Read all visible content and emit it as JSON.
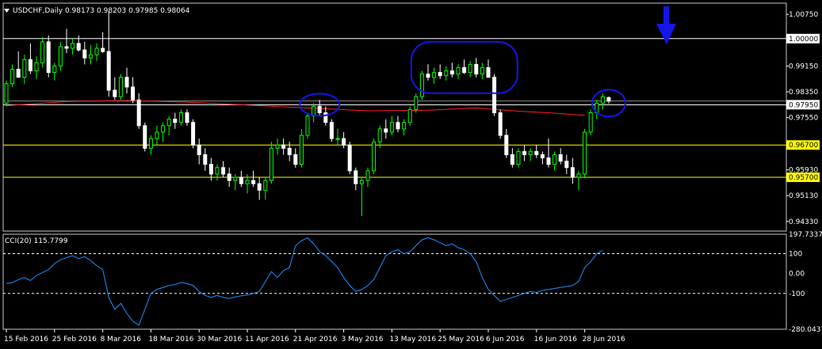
{
  "window": {
    "symbol_title": "USDCHF,Daily  0.98173 0.98203 0.97985 0.98064",
    "menu_icon": "triangle-down-icon"
  },
  "colors": {
    "background": "#000000",
    "frame": "#c8c8c8",
    "bull_candle": "#00ff00",
    "bear_candle": "#ffffff",
    "ma_line": "#ff2020",
    "hline_white": "#ffffff",
    "hline_yellow": "#ffff00",
    "label_bg_yellow": "#ffff00",
    "label_bg_white": "#ffffff",
    "cci_line": "#1e90ff",
    "annotation": "#1515e6"
  },
  "chart_data": [
    {
      "type": "candlestick",
      "title": "USDCHF,Daily  0.98173 0.98203 0.97985 0.98064",
      "ylim": [
        0.9408,
        1.0105
      ],
      "y_ticks": [
        "1.00750",
        "0.99150",
        "0.98350",
        "0.97550",
        "0.95930",
        "0.95130",
        "0.94330"
      ],
      "date_ticks": [
        "15 Feb 2016",
        "25 Feb 2016",
        "8 Mar 2016",
        "18 Mar 2016",
        "30 Mar 2016",
        "11 Apr 2016",
        "21 Apr 2016",
        "3 May 2016",
        "13 May 2016",
        "25 May 2016",
        "6 Jun 2016",
        "16 Jun 2016",
        "28 Jun 2016"
      ],
      "date_tick_index": [
        0,
        8,
        16,
        24,
        32,
        40,
        48,
        56,
        64,
        72,
        80,
        88,
        96
      ],
      "horizontal_levels": [
        {
          "value": 1.0,
          "label": "1.00000",
          "color": "white"
        },
        {
          "value": 0.9795,
          "label": "0.97950",
          "color": "white"
        },
        {
          "value": 0.967,
          "label": "0.96700",
          "color": "yellow"
        },
        {
          "value": 0.957,
          "label": "0.95700",
          "color": "yellow"
        }
      ],
      "current_price": 0.98064,
      "moving_average": {
        "points": [
          [
            0,
            0.9792
          ],
          [
            10,
            0.9805
          ],
          [
            20,
            0.9808
          ],
          [
            30,
            0.9803
          ],
          [
            40,
            0.9794
          ],
          [
            50,
            0.9785
          ],
          [
            60,
            0.9776
          ],
          [
            70,
            0.9778
          ],
          [
            78,
            0.9785
          ],
          [
            85,
            0.9775
          ],
          [
            90,
            0.977
          ],
          [
            96,
            0.9762
          ]
        ]
      },
      "candles": [
        {
          "o": 0.98,
          "h": 0.987,
          "l": 0.979,
          "c": 0.986
        },
        {
          "o": 0.986,
          "h": 0.992,
          "l": 0.985,
          "c": 0.9905
        },
        {
          "o": 0.9905,
          "h": 0.996,
          "l": 0.988,
          "c": 0.988
        },
        {
          "o": 0.988,
          "h": 0.995,
          "l": 0.986,
          "c": 0.9935
        },
        {
          "o": 0.9935,
          "h": 0.9985,
          "l": 0.989,
          "c": 0.99
        },
        {
          "o": 0.99,
          "h": 0.9945,
          "l": 0.9875,
          "c": 0.9925
        },
        {
          "o": 0.9925,
          "h": 1.0005,
          "l": 0.991,
          "c": 0.999
        },
        {
          "o": 0.999,
          "h": 1.001,
          "l": 0.988,
          "c": 0.9895
        },
        {
          "o": 0.9895,
          "h": 0.9925,
          "l": 0.987,
          "c": 0.9915
        },
        {
          "o": 0.9915,
          "h": 0.999,
          "l": 0.99,
          "c": 0.9975
        },
        {
          "o": 0.9975,
          "h": 1.003,
          "l": 0.9955,
          "c": 0.997
        },
        {
          "o": 0.997,
          "h": 1.0,
          "l": 0.995,
          "c": 0.9985
        },
        {
          "o": 0.9985,
          "h": 1.001,
          "l": 0.996,
          "c": 0.9965
        },
        {
          "o": 0.9965,
          "h": 0.999,
          "l": 0.992,
          "c": 0.994
        },
        {
          "o": 0.994,
          "h": 0.998,
          "l": 0.992,
          "c": 0.995
        },
        {
          "o": 0.995,
          "h": 0.9985,
          "l": 0.993,
          "c": 0.997
        },
        {
          "o": 0.997,
          "h": 1.002,
          "l": 0.9955,
          "c": 0.996
        },
        {
          "o": 0.996,
          "h": 1.0085,
          "l": 0.982,
          "c": 0.984
        },
        {
          "o": 0.984,
          "h": 0.988,
          "l": 0.981,
          "c": 0.982
        },
        {
          "o": 0.982,
          "h": 0.989,
          "l": 0.981,
          "c": 0.988
        },
        {
          "o": 0.988,
          "h": 0.991,
          "l": 0.983,
          "c": 0.985
        },
        {
          "o": 0.985,
          "h": 0.988,
          "l": 0.98,
          "c": 0.981
        },
        {
          "o": 0.981,
          "h": 0.983,
          "l": 0.972,
          "c": 0.973
        },
        {
          "o": 0.973,
          "h": 0.974,
          "l": 0.965,
          "c": 0.966
        },
        {
          "o": 0.966,
          "h": 0.97,
          "l": 0.964,
          "c": 0.969
        },
        {
          "o": 0.969,
          "h": 0.973,
          "l": 0.967,
          "c": 0.971
        },
        {
          "o": 0.971,
          "h": 0.974,
          "l": 0.968,
          "c": 0.973
        },
        {
          "o": 0.973,
          "h": 0.976,
          "l": 0.97,
          "c": 0.975
        },
        {
          "o": 0.975,
          "h": 0.977,
          "l": 0.972,
          "c": 0.974
        },
        {
          "o": 0.974,
          "h": 0.978,
          "l": 0.973,
          "c": 0.977
        },
        {
          "o": 0.977,
          "h": 0.978,
          "l": 0.973,
          "c": 0.974
        },
        {
          "o": 0.974,
          "h": 0.975,
          "l": 0.966,
          "c": 0.967
        },
        {
          "o": 0.967,
          "h": 0.969,
          "l": 0.961,
          "c": 0.964
        },
        {
          "o": 0.964,
          "h": 0.966,
          "l": 0.959,
          "c": 0.961
        },
        {
          "o": 0.961,
          "h": 0.963,
          "l": 0.956,
          "c": 0.958
        },
        {
          "o": 0.958,
          "h": 0.961,
          "l": 0.956,
          "c": 0.96
        },
        {
          "o": 0.96,
          "h": 0.962,
          "l": 0.957,
          "c": 0.958
        },
        {
          "o": 0.958,
          "h": 0.96,
          "l": 0.954,
          "c": 0.956
        },
        {
          "o": 0.956,
          "h": 0.958,
          "l": 0.953,
          "c": 0.957
        },
        {
          "o": 0.957,
          "h": 0.959,
          "l": 0.954,
          "c": 0.955
        },
        {
          "o": 0.955,
          "h": 0.958,
          "l": 0.952,
          "c": 0.956
        },
        {
          "o": 0.956,
          "h": 0.959,
          "l": 0.954,
          "c": 0.955
        },
        {
          "o": 0.955,
          "h": 0.957,
          "l": 0.95,
          "c": 0.953
        },
        {
          "o": 0.953,
          "h": 0.957,
          "l": 0.95,
          "c": 0.956
        },
        {
          "o": 0.956,
          "h": 0.968,
          "l": 0.955,
          "c": 0.966
        },
        {
          "o": 0.966,
          "h": 0.969,
          "l": 0.964,
          "c": 0.967
        },
        {
          "o": 0.967,
          "h": 0.969,
          "l": 0.964,
          "c": 0.966
        },
        {
          "o": 0.966,
          "h": 0.968,
          "l": 0.962,
          "c": 0.964
        },
        {
          "o": 0.964,
          "h": 0.966,
          "l": 0.96,
          "c": 0.961
        },
        {
          "o": 0.961,
          "h": 0.972,
          "l": 0.96,
          "c": 0.97
        },
        {
          "o": 0.97,
          "h": 0.977,
          "l": 0.969,
          "c": 0.976
        },
        {
          "o": 0.976,
          "h": 0.98,
          "l": 0.974,
          "c": 0.979
        },
        {
          "o": 0.979,
          "h": 0.981,
          "l": 0.976,
          "c": 0.977
        },
        {
          "o": 0.977,
          "h": 0.979,
          "l": 0.973,
          "c": 0.974
        },
        {
          "o": 0.974,
          "h": 0.975,
          "l": 0.968,
          "c": 0.969
        },
        {
          "o": 0.969,
          "h": 0.972,
          "l": 0.967,
          "c": 0.969
        },
        {
          "o": 0.969,
          "h": 0.971,
          "l": 0.966,
          "c": 0.967
        },
        {
          "o": 0.967,
          "h": 0.968,
          "l": 0.958,
          "c": 0.959
        },
        {
          "o": 0.959,
          "h": 0.96,
          "l": 0.953,
          "c": 0.955
        },
        {
          "o": 0.955,
          "h": 0.957,
          "l": 0.945,
          "c": 0.956
        },
        {
          "o": 0.956,
          "h": 0.96,
          "l": 0.954,
          "c": 0.959
        },
        {
          "o": 0.959,
          "h": 0.969,
          "l": 0.958,
          "c": 0.968
        },
        {
          "o": 0.968,
          "h": 0.973,
          "l": 0.966,
          "c": 0.972
        },
        {
          "o": 0.972,
          "h": 0.975,
          "l": 0.969,
          "c": 0.971
        },
        {
          "o": 0.971,
          "h": 0.976,
          "l": 0.97,
          "c": 0.974
        },
        {
          "o": 0.974,
          "h": 0.976,
          "l": 0.971,
          "c": 0.972
        },
        {
          "o": 0.972,
          "h": 0.975,
          "l": 0.97,
          "c": 0.974
        },
        {
          "o": 0.974,
          "h": 0.979,
          "l": 0.973,
          "c": 0.978
        },
        {
          "o": 0.978,
          "h": 0.983,
          "l": 0.977,
          "c": 0.982
        },
        {
          "o": 0.982,
          "h": 0.99,
          "l": 0.981,
          "c": 0.989
        },
        {
          "o": 0.989,
          "h": 0.992,
          "l": 0.987,
          "c": 0.988
        },
        {
          "o": 0.988,
          "h": 0.991,
          "l": 0.986,
          "c": 0.9895
        },
        {
          "o": 0.9895,
          "h": 0.992,
          "l": 0.9875,
          "c": 0.9885
        },
        {
          "o": 0.9885,
          "h": 0.9915,
          "l": 0.987,
          "c": 0.99
        },
        {
          "o": 0.99,
          "h": 0.9925,
          "l": 0.988,
          "c": 0.989
        },
        {
          "o": 0.989,
          "h": 0.992,
          "l": 0.9875,
          "c": 0.991
        },
        {
          "o": 0.991,
          "h": 0.9935,
          "l": 0.989,
          "c": 0.9895
        },
        {
          "o": 0.9895,
          "h": 0.993,
          "l": 0.988,
          "c": 0.992
        },
        {
          "o": 0.992,
          "h": 0.994,
          "l": 0.988,
          "c": 0.989
        },
        {
          "o": 0.989,
          "h": 0.9925,
          "l": 0.9875,
          "c": 0.991
        },
        {
          "o": 0.991,
          "h": 0.9935,
          "l": 0.988,
          "c": 0.988
        },
        {
          "o": 0.988,
          "h": 0.989,
          "l": 0.976,
          "c": 0.977
        },
        {
          "o": 0.977,
          "h": 0.978,
          "l": 0.969,
          "c": 0.97
        },
        {
          "o": 0.97,
          "h": 0.972,
          "l": 0.963,
          "c": 0.964
        },
        {
          "o": 0.964,
          "h": 0.966,
          "l": 0.96,
          "c": 0.961
        },
        {
          "o": 0.961,
          "h": 0.966,
          "l": 0.96,
          "c": 0.965
        },
        {
          "o": 0.965,
          "h": 0.967,
          "l": 0.962,
          "c": 0.964
        },
        {
          "o": 0.964,
          "h": 0.966,
          "l": 0.962,
          "c": 0.965
        },
        {
          "o": 0.965,
          "h": 0.967,
          "l": 0.963,
          "c": 0.964
        },
        {
          "o": 0.964,
          "h": 0.965,
          "l": 0.961,
          "c": 0.963
        },
        {
          "o": 0.963,
          "h": 0.969,
          "l": 0.96,
          "c": 0.961
        },
        {
          "o": 0.961,
          "h": 0.965,
          "l": 0.959,
          "c": 0.964
        },
        {
          "o": 0.964,
          "h": 0.966,
          "l": 0.961,
          "c": 0.962
        },
        {
          "o": 0.962,
          "h": 0.964,
          "l": 0.958,
          "c": 0.96
        },
        {
          "o": 0.96,
          "h": 0.963,
          "l": 0.955,
          "c": 0.957
        },
        {
          "o": 0.957,
          "h": 0.959,
          "l": 0.953,
          "c": 0.958
        },
        {
          "o": 0.958,
          "h": 0.972,
          "l": 0.957,
          "c": 0.971
        },
        {
          "o": 0.971,
          "h": 0.978,
          "l": 0.97,
          "c": 0.977
        },
        {
          "o": 0.977,
          "h": 0.981,
          "l": 0.975,
          "c": 0.98
        },
        {
          "o": 0.98,
          "h": 0.983,
          "l": 0.978,
          "c": 0.982
        },
        {
          "o": 0.98173,
          "h": 0.98203,
          "l": 0.97985,
          "c": 0.98064
        }
      ]
    },
    {
      "type": "line",
      "title": "CCI(20) 115.7799",
      "ylim": [
        -280.0437,
        197.7337
      ],
      "y_ticks": [
        "197.7337",
        "100",
        "0.00",
        "-100",
        "-280.0437"
      ],
      "levels": [
        100,
        -100
      ],
      "series": [
        {
          "values": [
            -50,
            -45,
            -30,
            -20,
            -35,
            -10,
            5,
            20,
            50,
            70,
            80,
            90,
            75,
            85,
            65,
            40,
            20,
            -120,
            -180,
            -150,
            -200,
            -240,
            -260,
            -180,
            -100,
            -80,
            -70,
            -60,
            -55,
            -45,
            -50,
            -60,
            -90,
            -110,
            -120,
            -110,
            -120,
            -125,
            -118,
            -112,
            -108,
            -100,
            -90,
            -40,
            10,
            -20,
            15,
            30,
            140,
            165,
            180,
            150,
            110,
            90,
            60,
            30,
            -20,
            -60,
            -90,
            -80,
            -60,
            -30,
            30,
            90,
            110,
            120,
            100,
            110,
            140,
            170,
            180,
            170,
            155,
            140,
            150,
            130,
            120,
            100,
            60,
            -20,
            -80,
            -110,
            -140,
            -130,
            -120,
            -110,
            -100,
            -90,
            -95,
            -85,
            -80,
            -75,
            -70,
            -65,
            -60,
            -40,
            30,
            60,
            100,
            115.7799
          ]
        }
      ]
    }
  ]
}
